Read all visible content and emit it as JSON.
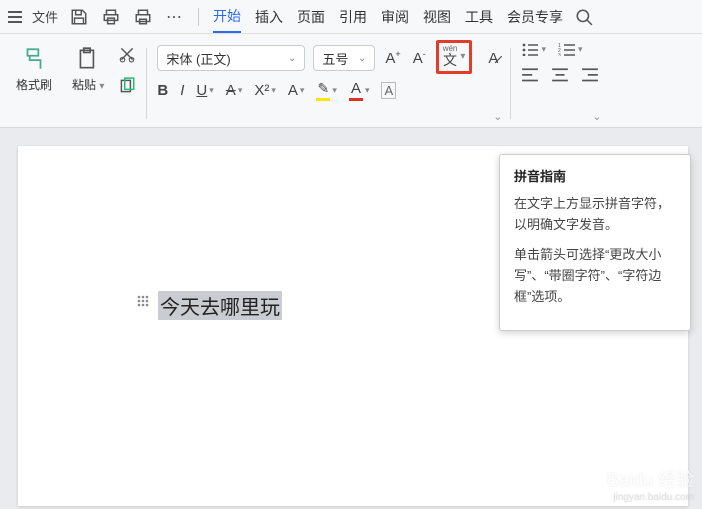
{
  "topbar": {
    "file_label": "文件",
    "tabs": [
      "开始",
      "插入",
      "页面",
      "引用",
      "审阅",
      "视图",
      "工具",
      "会员专享"
    ],
    "active_tab_index": 0
  },
  "ribbon": {
    "format_painter": "格式刷",
    "paste": "粘贴",
    "font_name": "宋体 (正文)",
    "font_size": "五号",
    "increase_font": "A⁺",
    "decrease_font": "A⁻",
    "phonetic_pin": "wén",
    "phonetic_han": "文",
    "bold": "B",
    "italic": "I",
    "underline": "U",
    "strike": "A",
    "super": "X²",
    "sub": "A",
    "highlight": "A",
    "font_color": "A",
    "boxed_char": "A"
  },
  "document": {
    "selected_text": "今天去哪里玩"
  },
  "tooltip": {
    "title": "拼音指南",
    "body1": "在文字上方显示拼音字符，以明确文字发音。",
    "body2": "单击箭头可选择“更改大小写”、“带圈字符”、“字符边框”选项。"
  },
  "watermark": {
    "main": "Baidu 经验",
    "sub": "jingyan.baidu.com"
  }
}
